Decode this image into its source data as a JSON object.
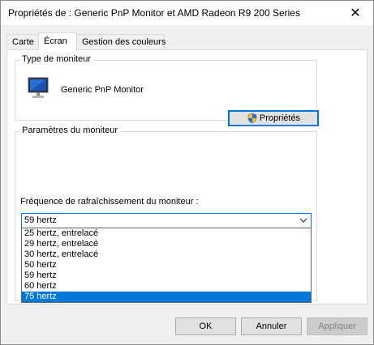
{
  "window": {
    "title": "Propriétés de : Generic PnP Monitor et AMD Radeon R9 200 Series",
    "close_glyph": "✕"
  },
  "tabs": [
    {
      "label": "Carte"
    },
    {
      "label": "Écran"
    },
    {
      "label": "Gestion des couleurs"
    }
  ],
  "monitor_type": {
    "legend": "Type de moniteur",
    "name": "Generic PnP Monitor",
    "properties_button": "Propriétés"
  },
  "monitor_settings": {
    "legend": "Paramètres du moniteur",
    "refresh_label": "Fréquence de rafraîchissement du moniteur :",
    "selected_value": "59 hertz",
    "options": [
      {
        "label": "25 hertz, entrelacé"
      },
      {
        "label": "29 hertz, entrelacé"
      },
      {
        "label": "30 hertz, entrelacé"
      },
      {
        "label": "50 hertz"
      },
      {
        "label": "59 hertz"
      },
      {
        "label": "60 hertz"
      },
      {
        "label": "75 hertz"
      }
    ],
    "highlighted_option": "75 hertz"
  },
  "footer": {
    "ok": "OK",
    "cancel": "Annuler",
    "apply": "Appliquer"
  },
  "colors": {
    "accent": "#0078d7",
    "highlight_text": "#ffffff"
  }
}
